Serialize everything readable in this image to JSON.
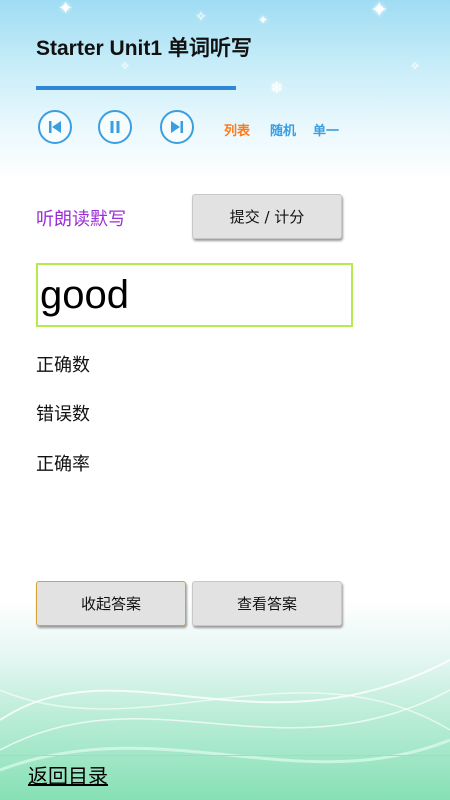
{
  "header": {
    "title": "Starter Unit1 单词听写",
    "progress": 0.0
  },
  "controls": {
    "prev_icon": "skip-previous-icon",
    "pause_icon": "pause-icon",
    "next_icon": "skip-next-icon",
    "modes": [
      {
        "label": "列表",
        "color": "#ff7a1a"
      },
      {
        "label": "随机",
        "color": "#3a9ee0"
      },
      {
        "label": "单一",
        "color": "#3a9ee0"
      }
    ]
  },
  "dictation": {
    "label": "听朗读默写",
    "submit_label": "提交 / 计分",
    "answer_value": "good"
  },
  "stats": {
    "correct_count_label": "正确数",
    "wrong_count_label": "错误数",
    "accuracy_label": "正确率"
  },
  "answer_buttons": {
    "hide_label": "收起答案",
    "view_label": "查看答案"
  },
  "footer": {
    "back_label": "返回目录"
  },
  "colors": {
    "accent": "#3a9ee0",
    "progress": "#2f86d6",
    "dictation_label": "#9b2fd6",
    "answer_border": "#b4ec4f"
  }
}
